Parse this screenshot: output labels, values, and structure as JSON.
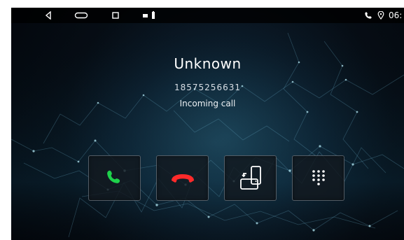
{
  "status_bar": {
    "nav_icons": [
      "back-icon",
      "home-icon",
      "recents-icon"
    ],
    "notification_icons": [
      "media-icon",
      "battery-icon"
    ],
    "right_icons": [
      "phone-icon",
      "location-icon"
    ],
    "time_text": "06:"
  },
  "call": {
    "caller_name": "Unknown",
    "caller_number": "18575256631",
    "status_text": "Incoming call"
  },
  "actions": [
    {
      "name": "answer",
      "icon": "phone-answer-icon",
      "color": "#1ed14b"
    },
    {
      "name": "decline",
      "icon": "phone-hangup-icon",
      "color": "#ff2a2a"
    },
    {
      "name": "switch-device",
      "icon": "switch-device-icon",
      "color": "#ffffff"
    },
    {
      "name": "keypad",
      "icon": "dialpad-icon",
      "color": "#ffffff"
    }
  ]
}
